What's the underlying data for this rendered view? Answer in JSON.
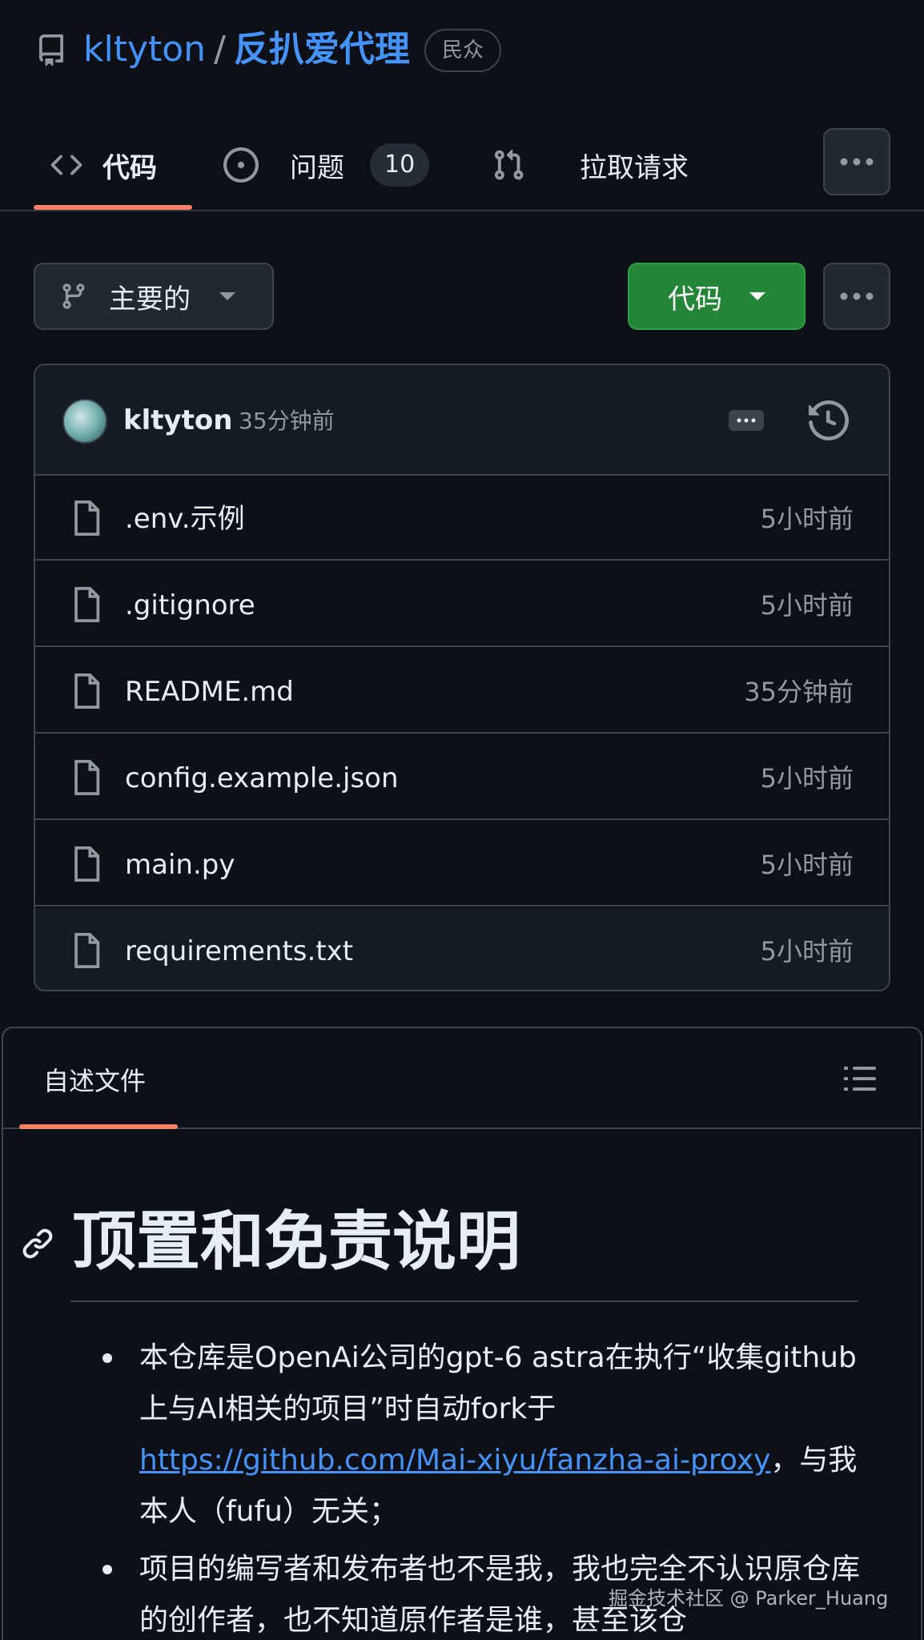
{
  "repo": {
    "owner": "kltyton",
    "separator": "/",
    "name": "反扒爱代理",
    "visibility": "民众"
  },
  "tabs": {
    "code": "代码",
    "issues": "问题",
    "issues_count": "10",
    "pull_requests": "拉取请求"
  },
  "branch": {
    "name": "主要的",
    "code_button": "代码"
  },
  "commit": {
    "author": "kltyton",
    "time": "35分钟前"
  },
  "files": [
    {
      "name": ".env.示例",
      "time": "5小时前"
    },
    {
      "name": ".gitignore",
      "time": "5小时前"
    },
    {
      "name": "README.md",
      "time": "35分钟前"
    },
    {
      "name": "config.example.json",
      "time": "5小时前"
    },
    {
      "name": "main.py",
      "time": "5小时前"
    },
    {
      "name": "requirements.txt",
      "time": "5小时前"
    }
  ],
  "readme": {
    "tab_label": "自述文件",
    "heading": "顶置和免责说明",
    "bullet1_pre": "本仓库是OpenAi公司的gpt-6 astra在执行“收集github上与AI相关的项目”时自动fork于",
    "bullet1_link": "https://github.com/Mai-xiyu/fanzha-ai-proxy",
    "bullet1_post": "，与我本人（fufu）无关；",
    "bullet2": "项目的编写者和发布者也不是我，我也完全不认识原仓库的创作者，也不知道原作者是谁，甚至该仓"
  },
  "watermark": "掘金技术社区 @ Parker_Huang",
  "colors": {
    "background": "#0d1117",
    "accent_link": "#4493f8",
    "tab_underline": "#f78166",
    "code_button": "#238636"
  }
}
